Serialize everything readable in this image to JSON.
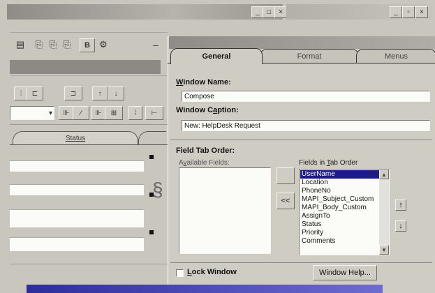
{
  "background_window": {
    "title": "",
    "title_buttons": [
      "_",
      "□",
      "×"
    ],
    "right_title_buttons": [
      "_",
      "▫",
      "×"
    ],
    "status_tab_label": "Status"
  },
  "dialog": {
    "tabs": [
      {
        "label": "General",
        "active": true
      },
      {
        "label": "Format",
        "active": false
      },
      {
        "label": "Menus",
        "active": false
      }
    ],
    "window_name": {
      "label_prefix": "",
      "label_accel": "W",
      "label_rest": "indow Name:",
      "value": "Compose"
    },
    "window_caption": {
      "label_prefix": "Window C",
      "label_accel": "a",
      "label_rest": "ption:",
      "value": "New: HelpDesk Request"
    },
    "field_tab_order_label": "Field Tab Order:",
    "available_fields": {
      "label_prefix": "A",
      "label_accel": "v",
      "label_rest": "ailable Fields:",
      "items": []
    },
    "fields_in_tab_order": {
      "label_prefix": "Fields in ",
      "label_accel": "T",
      "label_rest": "ab Order",
      "items": [
        "UserName",
        "Location",
        "PhoneNo",
        "MAPI_Subject_Custom",
        "MAPI_Body_Custom",
        "AssignTo",
        "Status",
        "Priority",
        "Comments"
      ],
      "selected_index": 0
    },
    "move_left_button": "<<",
    "move_right_button": "",
    "up_button": "↑",
    "down_button": "↓",
    "lock_window": {
      "checked": false,
      "label_accel": "L",
      "label_rest": "ock Window"
    },
    "window_help_button": "Window Help..."
  }
}
